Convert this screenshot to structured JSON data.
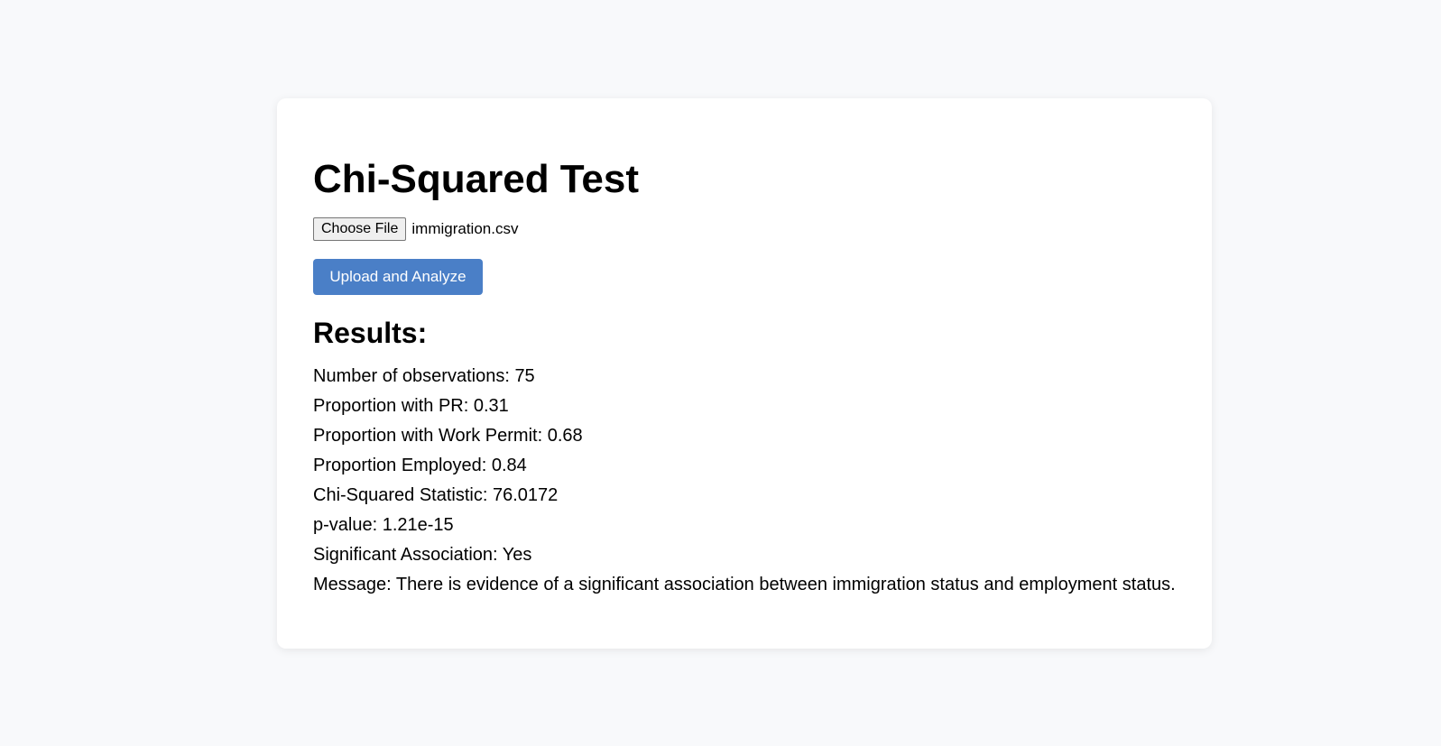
{
  "title": "Chi-Squared Test",
  "file_input": {
    "button_label": "Choose File",
    "file_name": "immigration.csv"
  },
  "upload_button_label": "Upload and Analyze",
  "results": {
    "heading": "Results:",
    "lines": [
      "Number of observations: 75",
      "Proportion with PR: 0.31",
      "Proportion with Work Permit: 0.68",
      "Proportion Employed: 0.84",
      "Chi-Squared Statistic: 76.0172",
      "p-value: 1.21e-15",
      "Significant Association: Yes",
      "Message: There is evidence of a significant association between immigration status and employment status."
    ]
  },
  "colors": {
    "page_background": "#f8f9fb",
    "card_background": "#ffffff",
    "accent": "#4a7fc7"
  }
}
